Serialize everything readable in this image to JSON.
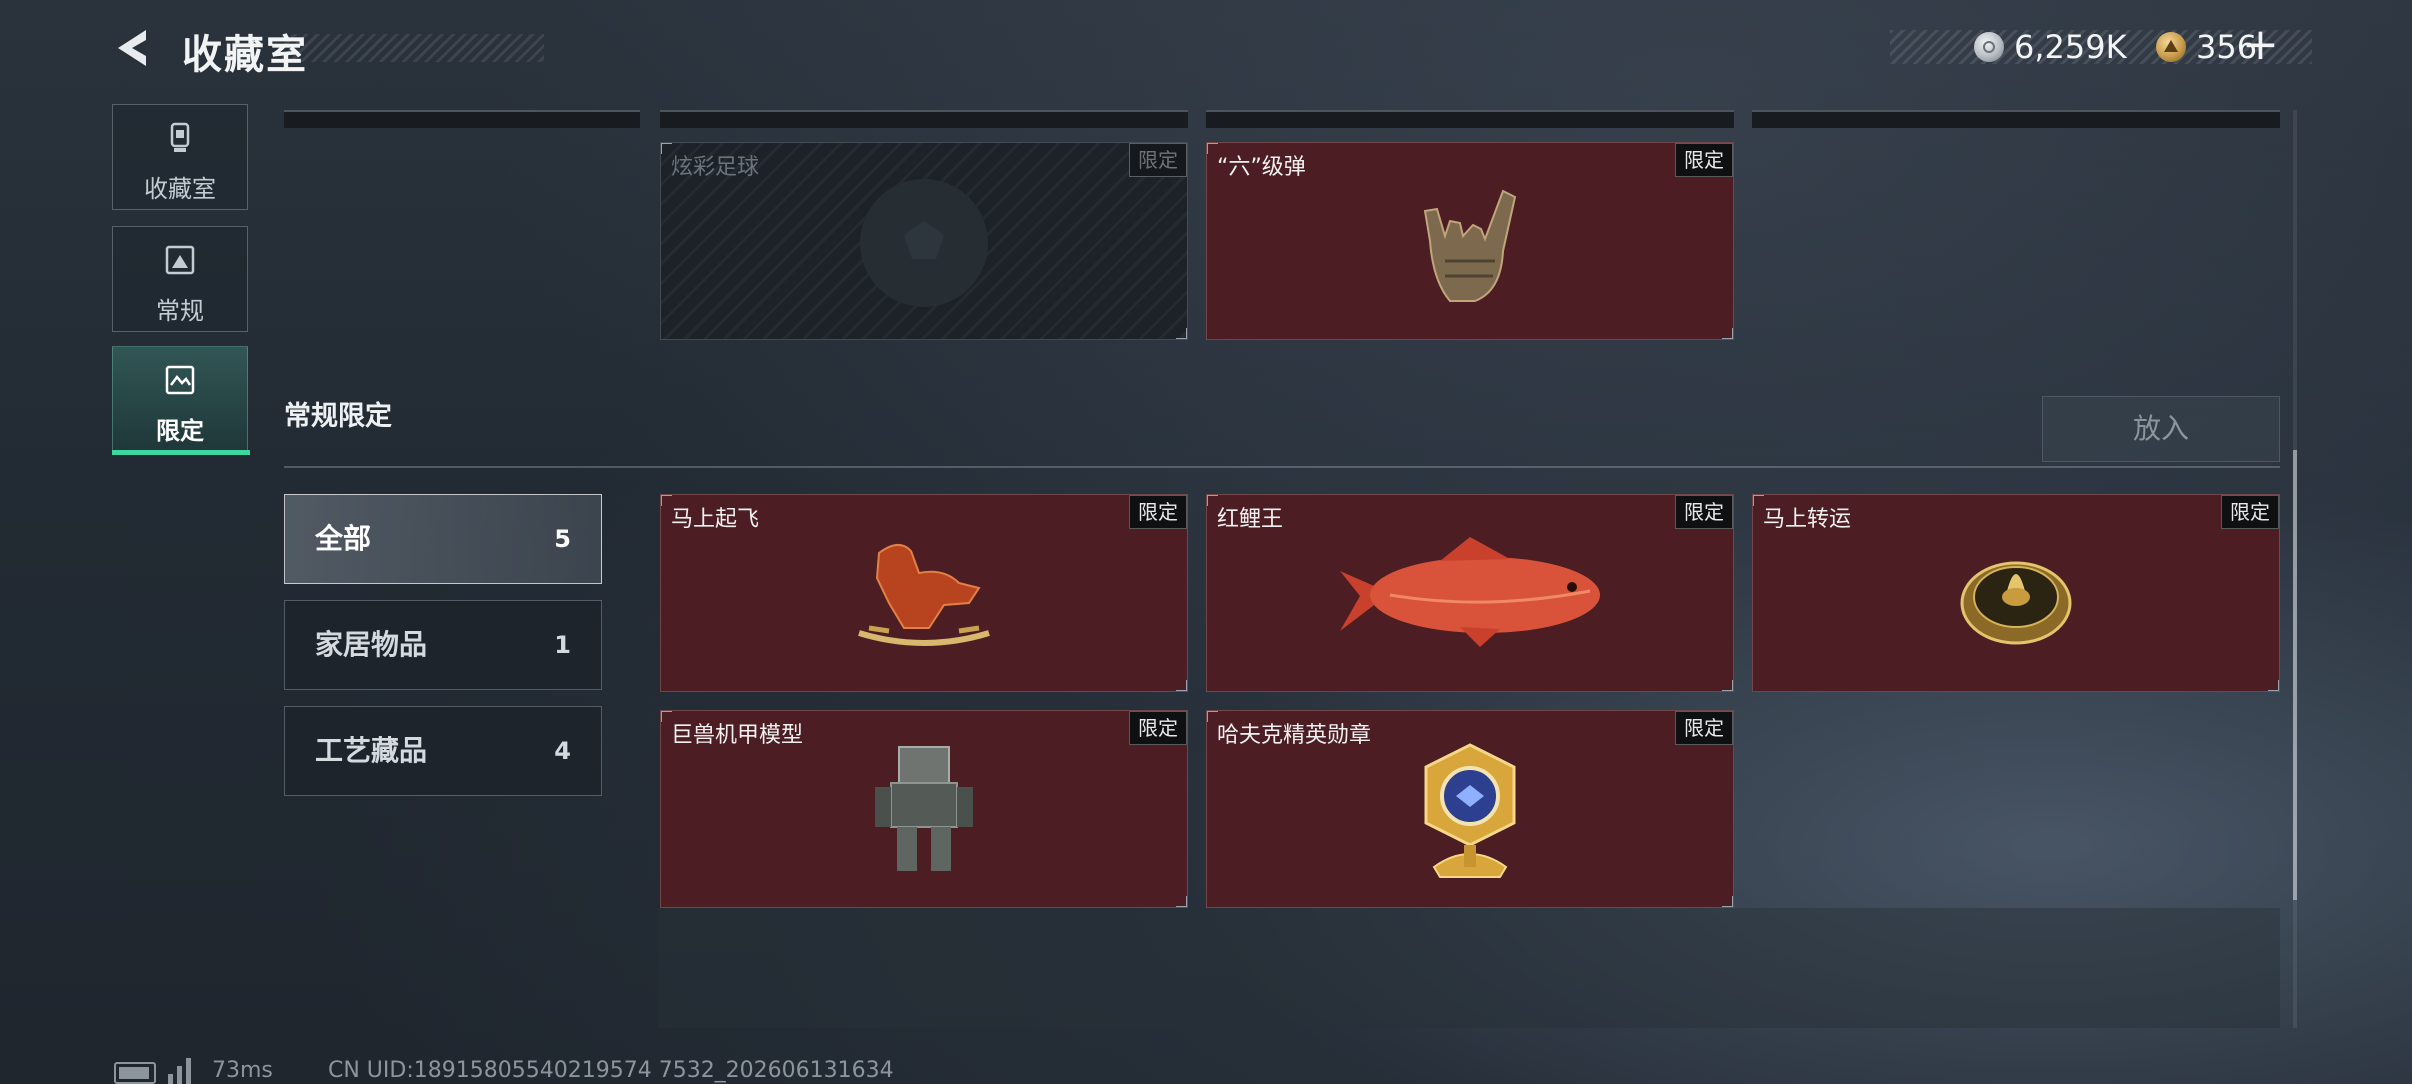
{
  "header": {
    "title": "收藏室",
    "currency": {
      "silver_value": "6,259K",
      "gold_value": "356",
      "add_label": "+"
    }
  },
  "sidebar": {
    "items": [
      {
        "label": "收藏室",
        "icon": "trophy-icon"
      },
      {
        "label": "常规",
        "icon": "image-icon"
      },
      {
        "label": "限定",
        "icon": "limited-image-icon",
        "active": true
      }
    ]
  },
  "top_items": [
    {
      "name": "炫彩足球",
      "tag": "限定",
      "locked": true,
      "icon": "soccer-ball-icon"
    },
    {
      "name": "“六”级弹",
      "tag": "限定",
      "locked": false,
      "icon": "shaka-hand-icon"
    }
  ],
  "section": {
    "title": "常规限定",
    "put_in_label": "放入"
  },
  "filters": [
    {
      "label": "全部",
      "count": "5",
      "selected": true
    },
    {
      "label": "家居物品",
      "count": "1",
      "selected": false
    },
    {
      "label": "工艺藏品",
      "count": "4",
      "selected": false
    }
  ],
  "items": [
    {
      "name": "马上起飞",
      "tag": "限定",
      "icon": "rocking-horse-icon"
    },
    {
      "name": "红鲤王",
      "tag": "限定",
      "icon": "red-carp-icon"
    },
    {
      "name": "马上转运",
      "tag": "限定",
      "icon": "golden-dial-icon"
    },
    {
      "name": "巨兽机甲模型",
      "tag": "限定",
      "icon": "mech-model-icon"
    },
    {
      "name": "哈夫克精英勋章",
      "tag": "限定",
      "icon": "elite-medal-icon"
    }
  ],
  "footer": {
    "ping": "73ms",
    "uid": "CN UID:18915805540219574 7532_202606131634"
  },
  "colors": {
    "accent_green": "#3fd7a0",
    "card_red": "#4c1d22",
    "background": "#232a33"
  }
}
